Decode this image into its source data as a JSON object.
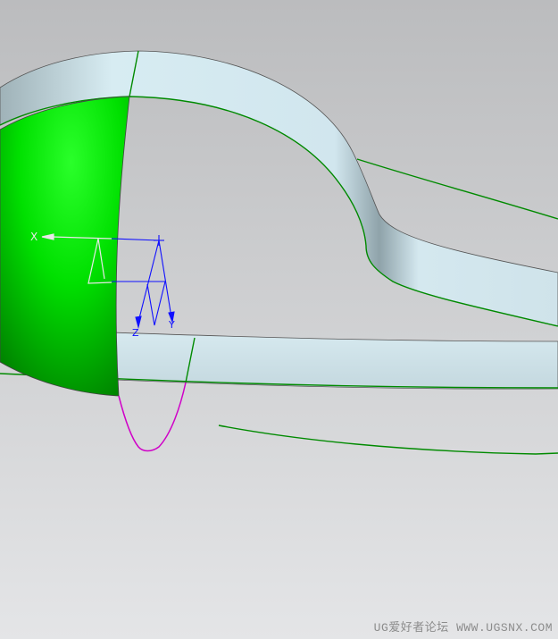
{
  "viewport": {
    "type": "cad-3d-graphics-window",
    "background_top": "#bbbcbe",
    "background_bottom": "#e4e5e7",
    "colors": {
      "sphere": "#00ee00",
      "surface": "#d3e7ee",
      "edge_curves": "#008a00",
      "section_curve": "#d000c8",
      "csys": "#1010ff",
      "wcs": "#e8e8e8"
    }
  },
  "csys": {
    "x_label": "X",
    "y_label": "Y",
    "z_label": "Z"
  },
  "watermark": "UG爱好者论坛 WWW.UGSNX.COM"
}
